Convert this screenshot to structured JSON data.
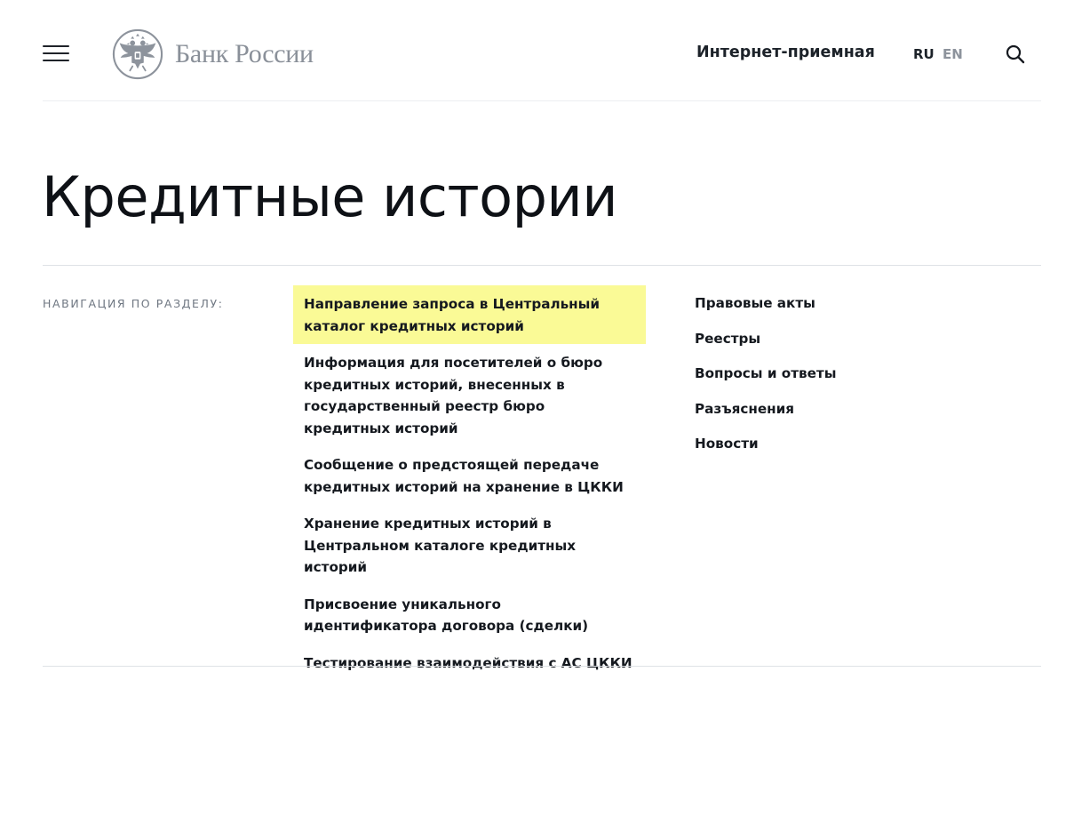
{
  "header": {
    "logo_text": "Банк России",
    "reception_label": "Интернет-приемная",
    "lang_ru": "RU",
    "lang_en": "EN"
  },
  "page": {
    "title": "Кредитные истории",
    "nav_label": "НАВИГАЦИЯ ПО РАЗДЕЛУ:"
  },
  "nav": {
    "primary": [
      "Направление запроса в Центральный каталог кредитных историй",
      "Информация для посетителей о бюро кредитных историй, внесенных в государственный реестр бюро кредитных историй",
      "Сообщение о предстоящей передаче кредитных историй на хранение в ЦККИ",
      "Хранение кредитных историй в Центральном каталоге кредитных историй",
      "Присвоение уникального идентификатора договора (сделки)",
      "Тестирование взаимодействия с АС ЦККИ"
    ],
    "secondary": [
      "Правовые акты",
      "Реестры",
      "Вопросы и ответы",
      "Разъяснения",
      "Новости"
    ]
  },
  "icons": {
    "menu": "hamburger-menu-icon",
    "logo": "double-headed-eagle-emblem",
    "search": "search-icon"
  },
  "colors": {
    "highlight": "#fafa96",
    "text": "#15191f",
    "muted": "#8a9099"
  }
}
